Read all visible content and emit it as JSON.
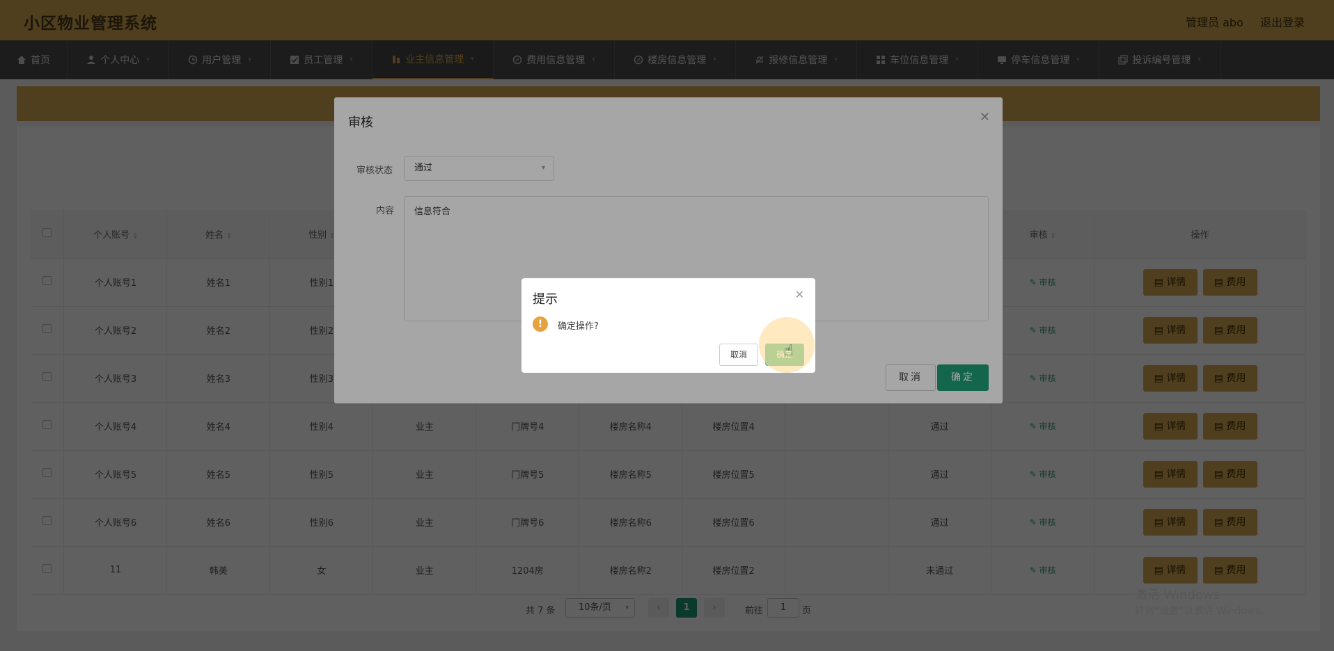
{
  "app": {
    "title": "小区物业管理系统",
    "admin": "管理员 abo",
    "logout": "退出登录"
  },
  "nav": {
    "items": [
      {
        "label": "首页",
        "icon": "home-icon"
      },
      {
        "label": "个人中心",
        "icon": "user-icon"
      },
      {
        "label": "用户管理",
        "icon": "clock-icon"
      },
      {
        "label": "员工管理",
        "icon": "check-icon"
      },
      {
        "label": "业主信息管理",
        "icon": "building-icon"
      },
      {
        "label": "费用信息管理",
        "icon": "compass-icon"
      },
      {
        "label": "楼房信息管理",
        "icon": "compass-icon"
      },
      {
        "label": "报修信息管理",
        "icon": "bell-off-icon"
      },
      {
        "label": "车位信息管理",
        "icon": "grid-icon"
      },
      {
        "label": "停车信息管理",
        "icon": "monitor-icon"
      },
      {
        "label": "投诉编号管理",
        "icon": "copy-icon"
      }
    ]
  },
  "table": {
    "headers": [
      "个人账号",
      "姓名",
      "性别",
      "审核",
      "操作"
    ],
    "rows": [
      {
        "account": "个人账号1",
        "name": "姓名1",
        "gender": "性别1",
        "type": "",
        "door": "",
        "bname": "",
        "bpos": "",
        "status": ""
      },
      {
        "account": "个人账号2",
        "name": "姓名2",
        "gender": "性别2",
        "type": "",
        "door": "",
        "bname": "",
        "bpos": "",
        "status": ""
      },
      {
        "account": "个人账号3",
        "name": "姓名3",
        "gender": "性别3",
        "type": "",
        "door": "",
        "bname": "",
        "bpos": "",
        "status": ""
      },
      {
        "account": "个人账号4",
        "name": "姓名4",
        "gender": "性别4",
        "type": "业主",
        "door": "门牌号4",
        "bname": "楼房名称4",
        "bpos": "楼房位置4",
        "status": "通过"
      },
      {
        "account": "个人账号5",
        "name": "姓名5",
        "gender": "性别5",
        "type": "业主",
        "door": "门牌号5",
        "bname": "楼房名称5",
        "bpos": "楼房位置5",
        "status": "通过"
      },
      {
        "account": "个人账号6",
        "name": "姓名6",
        "gender": "性别6",
        "type": "业主",
        "door": "门牌号6",
        "bname": "楼房名称6",
        "bpos": "楼房位置6",
        "status": "通过"
      },
      {
        "account": "11",
        "name": "韩美",
        "gender": "女",
        "type": "业主",
        "door": "1204房",
        "bname": "楼房名称2",
        "bpos": "楼房位置2",
        "status": "未通过"
      }
    ],
    "audit_label": "审核",
    "detail_label": "详情",
    "fee_label": "费用"
  },
  "pagination": {
    "total": "共 7 条",
    "page_size": "10条/页",
    "current": "1",
    "goto_prefix": "前往",
    "goto_value": "1",
    "goto_suffix": "页"
  },
  "dialog": {
    "title": "审核",
    "status_label": "审核状态",
    "status_value": "通过",
    "content_label": "内容",
    "content_value": "信息符合",
    "cancel": "取消",
    "confirm": "确定"
  },
  "msgbox": {
    "title": "提示",
    "message": "确定操作?",
    "cancel": "取消",
    "confirm": "确定"
  },
  "watermark": {
    "line1": "激活 Windows",
    "line2": "转到“设置”以激活 Windows。"
  },
  "colors": {
    "accent": "#d5aa50",
    "primary": "#1e9b75",
    "nav_bg": "#4a4a4a",
    "warning": "#e6a23c"
  }
}
